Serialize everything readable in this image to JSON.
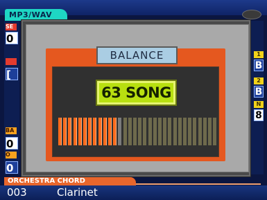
{
  "app": {
    "mode_tab": "MP3/WAV"
  },
  "left_panel": {
    "tags": [
      "SE",
      "",
      "BA",
      "O"
    ],
    "values": [
      "0",
      "[",
      "0",
      "0"
    ]
  },
  "right_panel": {
    "tags": [
      "1",
      "2",
      "N"
    ],
    "values": [
      "B",
      "B",
      "8"
    ]
  },
  "voice": {
    "category": "ORCHESTRA CHORD",
    "number": "003",
    "name": "Clarinet"
  },
  "dialog": {
    "title": "BALANCE",
    "value": "63 SONG",
    "meter": {
      "segments": 32,
      "song_fraction": 0.36
    }
  },
  "colors": {
    "meter_song": "#ff6a1a",
    "meter_song_edge": "#ffd0b0",
    "meter_off": "#6e6a4c",
    "meter_divider": "#7a7a7a",
    "value_box": "#b8e010",
    "title_box": "#aacde3",
    "panel_orange": "#e5581f"
  }
}
